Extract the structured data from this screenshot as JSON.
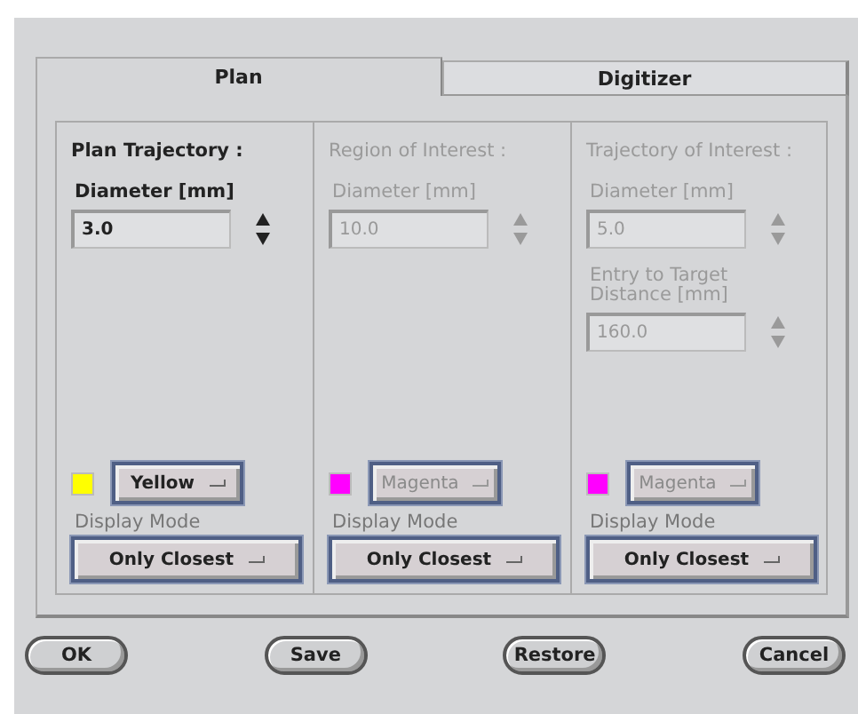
{
  "tabs": [
    {
      "label": "Plan",
      "selected": true
    },
    {
      "label": "Digitizer",
      "selected": false
    }
  ],
  "sections": [
    {
      "title": "Plan Trajectory :",
      "disabled": false,
      "fields": [
        {
          "label": "Diameter [mm]",
          "value": "3.0"
        }
      ],
      "color": "#ffff00",
      "color_name": "Yellow",
      "display_mode_label": "Display Mode",
      "display_mode": "Only Closest"
    },
    {
      "title": "Region of Interest :",
      "disabled": true,
      "fields": [
        {
          "label": "Diameter [mm]",
          "value": "10.0"
        }
      ],
      "color": "#ff00ff",
      "color_name": "Magenta",
      "display_mode_label": "Display Mode",
      "display_mode": "Only Closest"
    },
    {
      "title": "Trajectory of Interest :",
      "disabled": true,
      "fields": [
        {
          "label": "Diameter [mm]",
          "value": "5.0"
        },
        {
          "label": "Entry to Target Distance [mm]",
          "value": "160.0"
        }
      ],
      "color": "#ff00ff",
      "color_name": "Magenta",
      "display_mode_label": "Display Mode",
      "display_mode": "Only Closest"
    }
  ],
  "buttons": [
    "OK",
    "Save",
    "Restore",
    "Cancel"
  ]
}
